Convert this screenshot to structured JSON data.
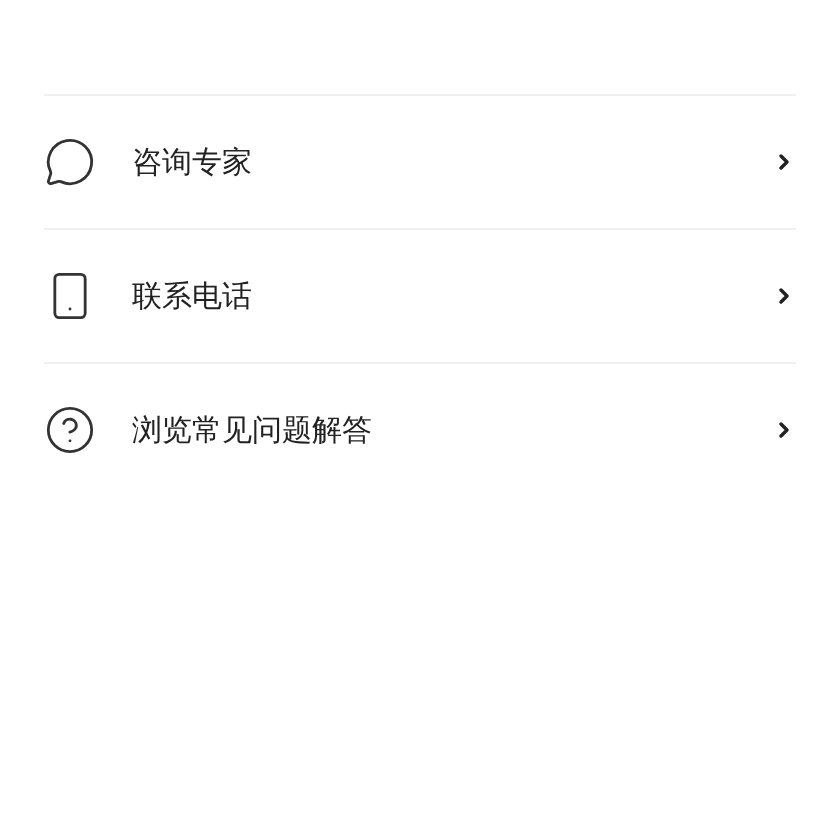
{
  "menu": [
    {
      "kind": "chat",
      "label": "咨询专家"
    },
    {
      "kind": "phone",
      "label": "联系电话"
    },
    {
      "kind": "help",
      "label": "浏览常见问题解答"
    }
  ]
}
